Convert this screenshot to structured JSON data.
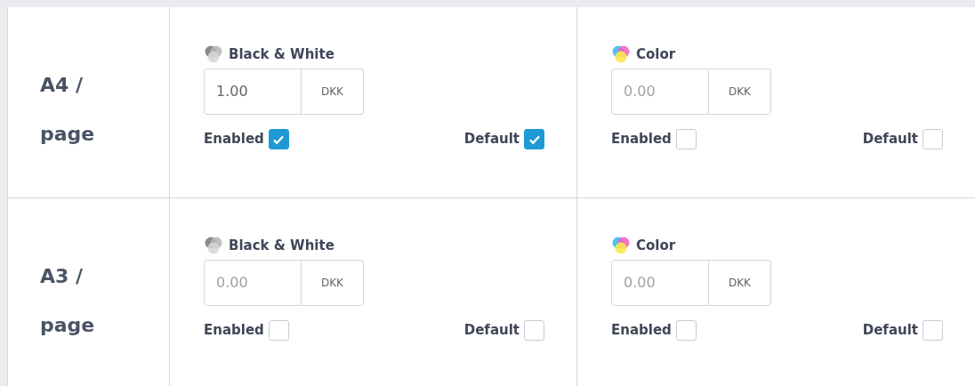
{
  "rows": [
    {
      "label": "A4 / page",
      "options": [
        {
          "kind": "bw",
          "title": "Black & White",
          "value": "1.00",
          "currency": "DKK",
          "enabled_label": "Enabled",
          "enabled": true,
          "default_label": "Default",
          "default": true
        },
        {
          "kind": "color",
          "title": "Color",
          "placeholder": "0.00",
          "currency": "DKK",
          "enabled_label": "Enabled",
          "enabled": false,
          "default_label": "Default",
          "default": false
        }
      ]
    },
    {
      "label": "A3 / page",
      "options": [
        {
          "kind": "bw",
          "title": "Black & White",
          "placeholder": "0.00",
          "currency": "DKK",
          "enabled_label": "Enabled",
          "enabled": false,
          "default_label": "Default",
          "default": false
        },
        {
          "kind": "color",
          "title": "Color",
          "placeholder": "0.00",
          "currency": "DKK",
          "enabled_label": "Enabled",
          "enabled": false,
          "default_label": "Default",
          "default": false
        }
      ]
    }
  ]
}
